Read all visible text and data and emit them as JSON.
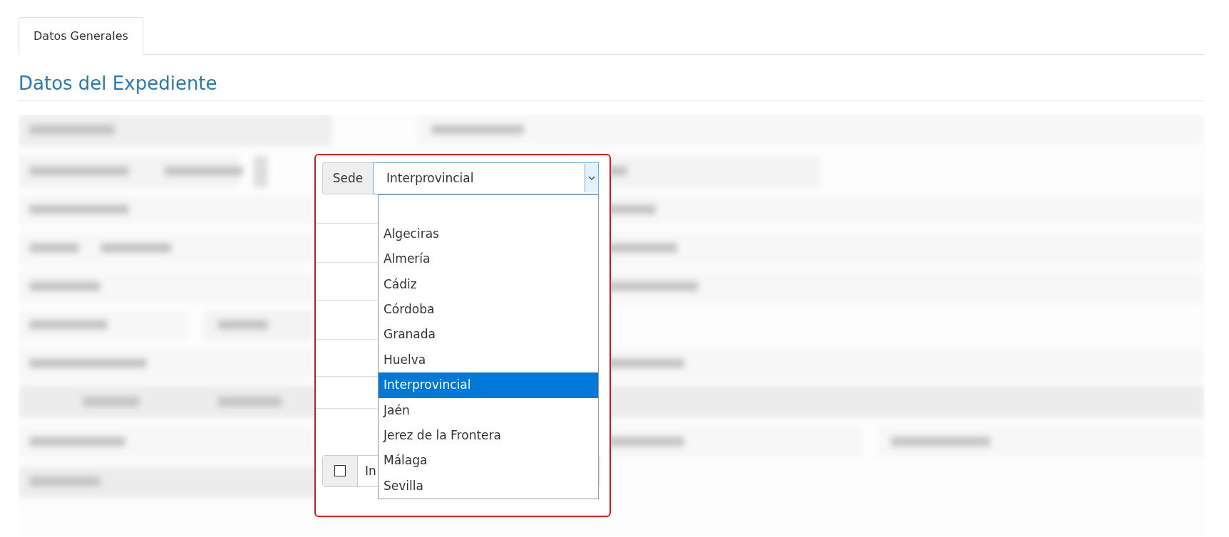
{
  "tabs": [
    {
      "label": "Datos Generales",
      "selected": true
    }
  ],
  "section_title": "Datos del Expediente",
  "sede": {
    "label": "Sede",
    "value": "Interprovincial",
    "expanded": true,
    "options": [
      {
        "label": "Algeciras",
        "selected": false
      },
      {
        "label": "Almería",
        "selected": false
      },
      {
        "label": "Cádiz",
        "selected": false
      },
      {
        "label": "Córdoba",
        "selected": false
      },
      {
        "label": "Granada",
        "selected": false
      },
      {
        "label": "Huelva",
        "selected": false
      },
      {
        "label": "Interprovincial",
        "selected": true
      },
      {
        "label": "Jaén",
        "selected": false
      },
      {
        "label": "Jerez de la Frontera",
        "selected": false
      },
      {
        "label": "Málaga",
        "selected": false
      },
      {
        "label": "Sevilla",
        "selected": false
      }
    ]
  },
  "checkbox_field": {
    "checked": false,
    "label": "In"
  }
}
